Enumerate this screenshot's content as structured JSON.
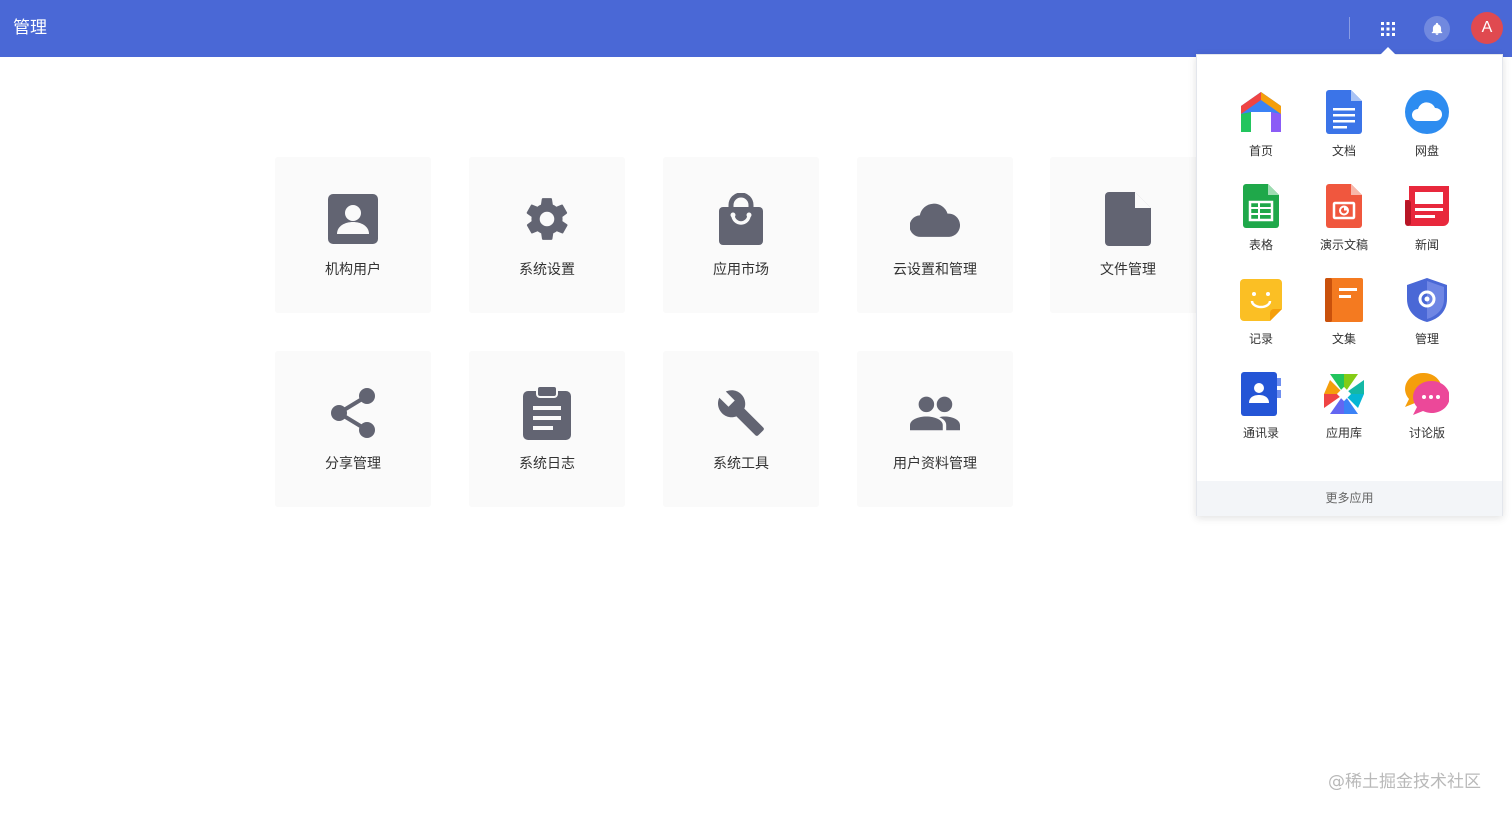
{
  "header": {
    "title": "管理",
    "avatar_letter": "A",
    "colors": {
      "bar": "#4a68d6",
      "avatar": "#e04a50"
    }
  },
  "tiles": [
    {
      "label": "机构用户",
      "icon": "account-box-icon"
    },
    {
      "label": "系统设置",
      "icon": "gear-icon"
    },
    {
      "label": "应用市场",
      "icon": "shopping-bag-icon"
    },
    {
      "label": "云设置和管理",
      "icon": "cloud-icon"
    },
    {
      "label": "文件管理",
      "icon": "file-icon"
    },
    {
      "label": "分享管理",
      "icon": "share-icon"
    },
    {
      "label": "系统日志",
      "icon": "clipboard-list-icon"
    },
    {
      "label": "系统工具",
      "icon": "wrench-icon"
    },
    {
      "label": "用户资料管理",
      "icon": "people-icon"
    }
  ],
  "app_panel": {
    "apps": [
      {
        "label": "首页",
        "icon": "home-app-icon"
      },
      {
        "label": "文档",
        "icon": "docs-app-icon"
      },
      {
        "label": "网盘",
        "icon": "cloud-drive-app-icon"
      },
      {
        "label": "表格",
        "icon": "sheets-app-icon"
      },
      {
        "label": "演示文稿",
        "icon": "slides-app-icon"
      },
      {
        "label": "新闻",
        "icon": "news-app-icon"
      },
      {
        "label": "记录",
        "icon": "notes-app-icon"
      },
      {
        "label": "文集",
        "icon": "book-app-icon"
      },
      {
        "label": "管理",
        "icon": "admin-shield-app-icon"
      },
      {
        "label": "通讯录",
        "icon": "contacts-app-icon"
      },
      {
        "label": "应用库",
        "icon": "app-library-icon"
      },
      {
        "label": "讨论版",
        "icon": "discussion-app-icon"
      }
    ],
    "more_label": "更多应用"
  },
  "watermark": "@稀土掘金技术社区"
}
